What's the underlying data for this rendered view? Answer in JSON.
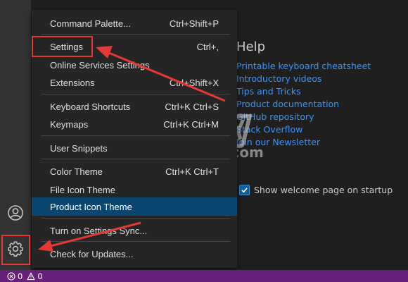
{
  "menu": {
    "items": [
      {
        "label": "Command Palette...",
        "shortcut": "Ctrl+Shift+P"
      },
      {
        "label": "Settings",
        "shortcut": "Ctrl+,"
      },
      {
        "label": "Online Services Settings",
        "shortcut": ""
      },
      {
        "label": "Extensions",
        "shortcut": "Ctrl+Shift+X"
      },
      {
        "label": "Keyboard Shortcuts",
        "shortcut": "Ctrl+K Ctrl+S"
      },
      {
        "label": "Keymaps",
        "shortcut": "Ctrl+K Ctrl+M"
      },
      {
        "label": "User Snippets",
        "shortcut": ""
      },
      {
        "label": "Color Theme",
        "shortcut": "Ctrl+K Ctrl+T"
      },
      {
        "label": "File Icon Theme",
        "shortcut": ""
      },
      {
        "label": "Product Icon Theme",
        "shortcut": ""
      },
      {
        "label": "Turn on Settings Sync...",
        "shortcut": ""
      },
      {
        "label": "Check for Updates...",
        "shortcut": ""
      }
    ],
    "highlighted": "Product Icon Theme"
  },
  "welcome": {
    "help_title": "Help",
    "links": [
      "Printable keyboard cheatsheet",
      "Introductory videos",
      "Tips and Tricks",
      "Product documentation",
      "GitHub repository",
      "Stack Overflow",
      "Join our Newsletter"
    ],
    "startup_label": "Show welcome page on startup",
    "startup_checked": true
  },
  "activity_bar": {
    "icons": [
      "account-icon",
      "gear-icon"
    ]
  },
  "statusbar": {
    "errors": "0",
    "warnings": "0"
  },
  "watermark": {
    "text": "GX/网",
    "domain": "system.com"
  },
  "colors": {
    "menu_highlight": "#094771",
    "link": "#3794ff",
    "statusbar": "#68217a",
    "annotation": "#e53935"
  }
}
